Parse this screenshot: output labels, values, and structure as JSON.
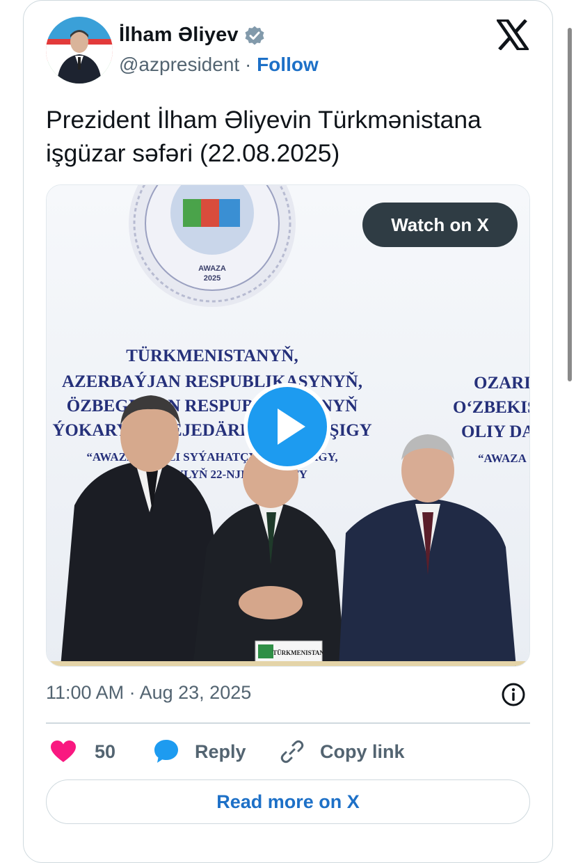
{
  "author": {
    "name": "İlham Əliyev",
    "handle": "@azpresident",
    "separator": "·",
    "follow_label": "Follow"
  },
  "tweet": {
    "text_line1": "Prezident İlham Əliyevin Türkmənistana",
    "text_line2": "işgüzar səfəri (22.08.2025)"
  },
  "media": {
    "watch_label": "Watch on X",
    "seal_text_1": "AWAZA",
    "seal_text_2": "2025",
    "banner_left": [
      "TÜRKMENISTANYŇ,",
      "AZERBAÝJAN RESPUBLIKASYNYŇ,",
      "ÖZBEGISTAN RESPUBLIKASYNYŇ",
      "ÝOKARY GEREJEDÄRLER GEŇEŞIGY",
      "“AWAZA” MILLI SYÝAHATÇYLYK ZOLAGY,",
      "2025-NJI ÝYLYŇ 22-NJI AWGUSTY"
    ],
    "banner_right": [
      "OZARI",
      "O‘ZBEKIS",
      "OLIY DA",
      "“AWAZA"
    ],
    "nameplate": "TÜRKMENISTAN"
  },
  "meta": {
    "time": "11:00 AM",
    "separator": "·",
    "date": "Aug 23, 2025"
  },
  "actions": {
    "like_count": "50",
    "reply_label": "Reply",
    "copy_label": "Copy link"
  },
  "read_more_label": "Read more on X",
  "colors": {
    "accent": "#1d70c7",
    "like": "#f91880",
    "reply": "#1d9bf0",
    "secondary_text": "#536471",
    "border": "#cfd9de"
  }
}
